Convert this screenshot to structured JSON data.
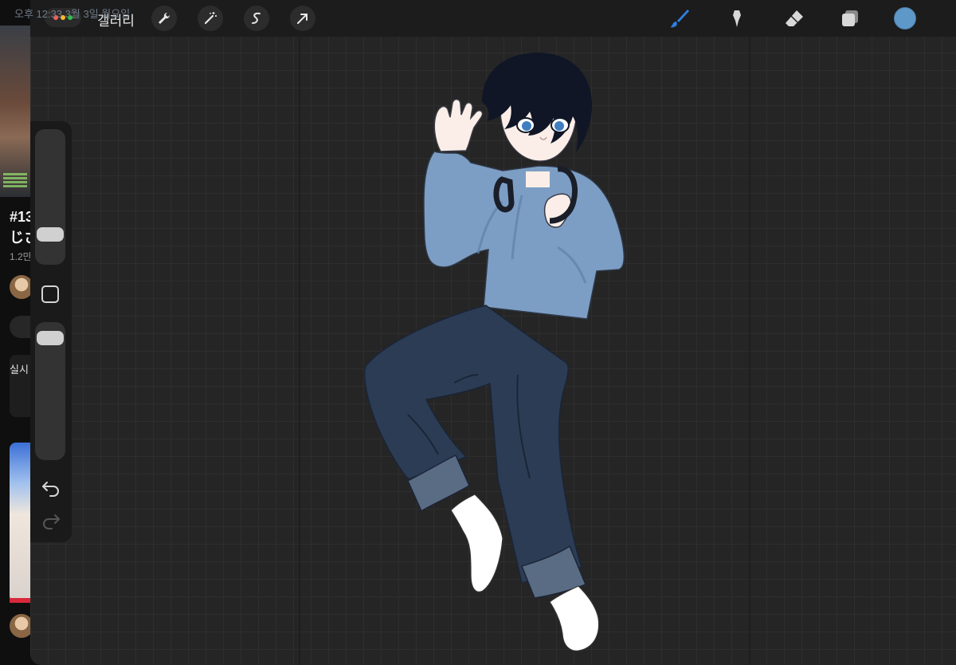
{
  "status_bar": {
    "time_date": "오후 12:33 3월 3일 월요일"
  },
  "background_app": {
    "title_line1": "#13",
    "title_line2": "じさ",
    "meta": "1.2만",
    "card_text": "실시"
  },
  "toolbar": {
    "gallery_label": "갤러리",
    "left_tools": [
      "wrench-icon",
      "magic-wand-icon",
      "selection-icon",
      "transform-arrow-icon"
    ],
    "right_tools": [
      "brush-icon",
      "smudge-icon",
      "eraser-icon",
      "layers-icon"
    ],
    "active_tool": "brush",
    "accent_color": "#2f7fe0",
    "current_color": "#5e98c9"
  },
  "sidebar": {
    "brush_size": 0.18,
    "opacity": 0.94
  },
  "canvas": {
    "background_color": "#252525",
    "grid": true
  }
}
